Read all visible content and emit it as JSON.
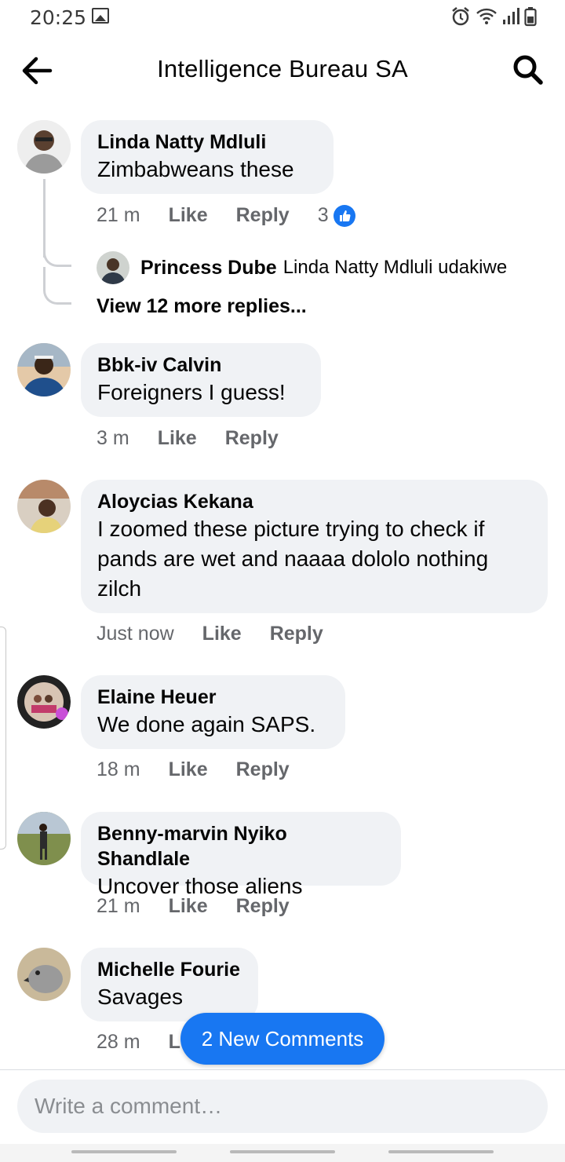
{
  "status_bar": {
    "time": "20:25",
    "icons": [
      "image-icon",
      "alarm-icon",
      "wifi-icon",
      "signal-icon",
      "battery-icon"
    ]
  },
  "header": {
    "title": "Intelligence Bureau SA",
    "back_icon": "arrow-left-icon",
    "search_icon": "search-icon"
  },
  "comments": [
    {
      "author": "Linda Natty Mdluli",
      "text": "Zimbabweans these",
      "time": "21 m",
      "like": "Like",
      "reply": "Reply",
      "like_count": "3",
      "replies": {
        "preview_author": "Princess Dube",
        "preview_text": "Linda Natty Mdluli udakiwe",
        "view_more": "View 12 more replies..."
      }
    },
    {
      "author": "Bbk-iv Calvin",
      "text": "Foreigners I guess!",
      "time": "3 m",
      "like": "Like",
      "reply": "Reply"
    },
    {
      "author": "Aloycias Kekana",
      "text_lines": [
        "I zoomed these picture trying to check if",
        "pands are wet and naaaa dololo nothing",
        "zilch"
      ],
      "time": "Just now",
      "like": "Like",
      "reply": "Reply"
    },
    {
      "author": "Elaine Heuer",
      "text": "We done again SAPS.",
      "time": "18 m",
      "like": "Like",
      "reply": "Reply"
    },
    {
      "author": "Benny-marvin Nyiko Shandlale",
      "text": "Uncover those aliens",
      "time": "21 m",
      "like": "Like",
      "reply": "Reply"
    },
    {
      "author": "Michelle Fourie",
      "text": "Savages",
      "time": "28 m",
      "like_partial": "L"
    }
  ],
  "new_comments_pill": "2 New Comments",
  "composer": {
    "placeholder": "Write a comment…"
  },
  "colors": {
    "accent": "#1877f2",
    "bubble": "#f0f2f5",
    "meta": "#65676b"
  }
}
